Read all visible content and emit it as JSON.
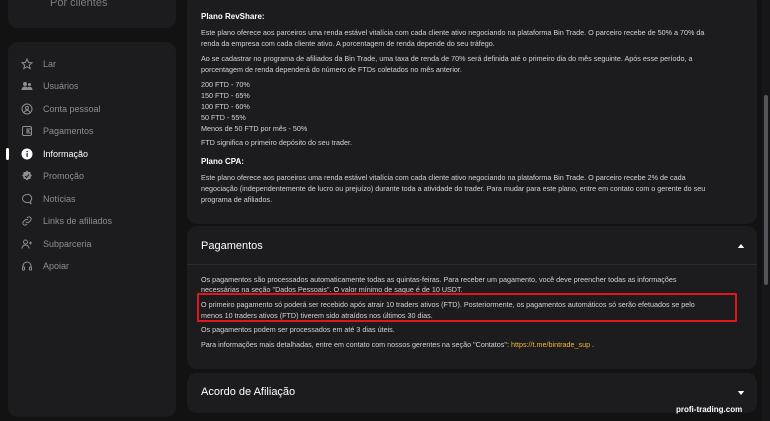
{
  "sidebar": {
    "top_label": "Por clientes",
    "items": [
      {
        "label": "Lar",
        "icon": "star-icon"
      },
      {
        "label": "Usuários",
        "icon": "users-icon"
      },
      {
        "label": "Conta pessoal",
        "icon": "account-icon"
      },
      {
        "label": "Pagamentos",
        "icon": "wallet-icon"
      },
      {
        "label": "Informação",
        "icon": "info-icon",
        "active": true
      },
      {
        "label": "Promoção",
        "icon": "badge-icon"
      },
      {
        "label": "Notícias",
        "icon": "chat-icon"
      },
      {
        "label": "Links de afiliados",
        "icon": "link-icon"
      },
      {
        "label": "Subparceria",
        "icon": "user-plus-icon"
      },
      {
        "label": "Apoiar",
        "icon": "headset-icon"
      }
    ]
  },
  "revshare": {
    "title": "Plano RevShare:",
    "p1": [
      "Este plano oferece aos parceiros uma renda estável vitalícia com cada cliente ativo negociando na plataforma Bin Trade. O parceiro recebe de 50% a 70% da",
      "renda da empresa com cada cliente ativo. A porcentagem de renda depende do seu tráfego."
    ],
    "p2": [
      "Ao se cadastrar no programa de afiliados da Bin Trade, uma taxa de renda de 70% será definida até o primeiro dia do mês seguinte. Após esse período, a",
      "porcentagem de renda dependerá do número de FTDs coletados no mês anterior."
    ],
    "tiers": [
      "200 FTD - 70%",
      "150 FTD - 65%",
      "100 FTD - 60%",
      "50 FTD - 55%",
      "Menos de 50 FTD por mês - 50%"
    ],
    "ftd_note": "FTD significa o primeiro depósito do seu trader."
  },
  "cpa": {
    "title": "Plano CPA:",
    "p1": [
      "Este plano oferece aos parceiros uma renda estável vitalícia com cada cliente ativo negociando na plataforma Bin Trade. O parceiro recebe 2% de cada",
      "negociação (independentemente de lucro ou prejuízo) durante toda a atividade do trader. Para mudar para este plano, entre em contato com o gerente do seu",
      "programa de afiliados."
    ]
  },
  "pagamentos": {
    "title": "Pagamentos",
    "p1": [
      "Os pagamentos são processados automaticamente todas as quintas-feiras. Para receber um pagamento, você deve preencher todas as informações",
      "necessárias na seção \"Dados Pessoais\". O valor mínimo de saque é de 10 USDT."
    ],
    "highlight": [
      "O primeiro pagamento só poderá ser recebido após atrair 10 traders ativos (FTD). Posteriormente, os pagamentos automáticos só serão efetuados se pelo",
      "menos 10 traders ativos (FTD) tiverem sido atraídos nos últimos 30 dias."
    ],
    "p3": "Os pagamentos podem ser processados em até 3 dias úteis.",
    "p4_prefix": "Para informações mais detalhadas, entre em contato com nossos gerentes na seção \"Contatos\": ",
    "p4_link": "https://t.me/bintrade_sup",
    "p4_suffix": " ."
  },
  "acordo": {
    "title": "Acordo de Afiliação"
  },
  "watermark": "profi-trading.com",
  "colors": {
    "background": "#121212",
    "card": "#1c1c1e",
    "highlight_border": "#e0161e",
    "link": "#f5b731"
  }
}
